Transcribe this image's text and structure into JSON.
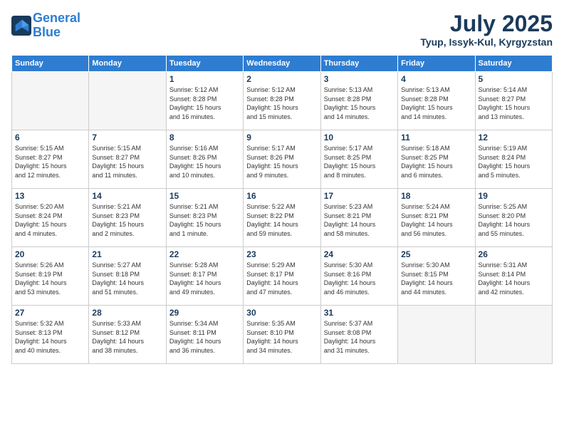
{
  "header": {
    "logo_line1": "General",
    "logo_line2": "Blue",
    "month_year": "July 2025",
    "location": "Tyup, Issyk-Kul, Kyrgyzstan"
  },
  "days_of_week": [
    "Sunday",
    "Monday",
    "Tuesday",
    "Wednesday",
    "Thursday",
    "Friday",
    "Saturday"
  ],
  "weeks": [
    [
      {
        "day": "",
        "content": ""
      },
      {
        "day": "",
        "content": ""
      },
      {
        "day": "1",
        "content": "Sunrise: 5:12 AM\nSunset: 8:28 PM\nDaylight: 15 hours\nand 16 minutes."
      },
      {
        "day": "2",
        "content": "Sunrise: 5:12 AM\nSunset: 8:28 PM\nDaylight: 15 hours\nand 15 minutes."
      },
      {
        "day": "3",
        "content": "Sunrise: 5:13 AM\nSunset: 8:28 PM\nDaylight: 15 hours\nand 14 minutes."
      },
      {
        "day": "4",
        "content": "Sunrise: 5:13 AM\nSunset: 8:28 PM\nDaylight: 15 hours\nand 14 minutes."
      },
      {
        "day": "5",
        "content": "Sunrise: 5:14 AM\nSunset: 8:27 PM\nDaylight: 15 hours\nand 13 minutes."
      }
    ],
    [
      {
        "day": "6",
        "content": "Sunrise: 5:15 AM\nSunset: 8:27 PM\nDaylight: 15 hours\nand 12 minutes."
      },
      {
        "day": "7",
        "content": "Sunrise: 5:15 AM\nSunset: 8:27 PM\nDaylight: 15 hours\nand 11 minutes."
      },
      {
        "day": "8",
        "content": "Sunrise: 5:16 AM\nSunset: 8:26 PM\nDaylight: 15 hours\nand 10 minutes."
      },
      {
        "day": "9",
        "content": "Sunrise: 5:17 AM\nSunset: 8:26 PM\nDaylight: 15 hours\nand 9 minutes."
      },
      {
        "day": "10",
        "content": "Sunrise: 5:17 AM\nSunset: 8:25 PM\nDaylight: 15 hours\nand 8 minutes."
      },
      {
        "day": "11",
        "content": "Sunrise: 5:18 AM\nSunset: 8:25 PM\nDaylight: 15 hours\nand 6 minutes."
      },
      {
        "day": "12",
        "content": "Sunrise: 5:19 AM\nSunset: 8:24 PM\nDaylight: 15 hours\nand 5 minutes."
      }
    ],
    [
      {
        "day": "13",
        "content": "Sunrise: 5:20 AM\nSunset: 8:24 PM\nDaylight: 15 hours\nand 4 minutes."
      },
      {
        "day": "14",
        "content": "Sunrise: 5:21 AM\nSunset: 8:23 PM\nDaylight: 15 hours\nand 2 minutes."
      },
      {
        "day": "15",
        "content": "Sunrise: 5:21 AM\nSunset: 8:23 PM\nDaylight: 15 hours\nand 1 minute."
      },
      {
        "day": "16",
        "content": "Sunrise: 5:22 AM\nSunset: 8:22 PM\nDaylight: 14 hours\nand 59 minutes."
      },
      {
        "day": "17",
        "content": "Sunrise: 5:23 AM\nSunset: 8:21 PM\nDaylight: 14 hours\nand 58 minutes."
      },
      {
        "day": "18",
        "content": "Sunrise: 5:24 AM\nSunset: 8:21 PM\nDaylight: 14 hours\nand 56 minutes."
      },
      {
        "day": "19",
        "content": "Sunrise: 5:25 AM\nSunset: 8:20 PM\nDaylight: 14 hours\nand 55 minutes."
      }
    ],
    [
      {
        "day": "20",
        "content": "Sunrise: 5:26 AM\nSunset: 8:19 PM\nDaylight: 14 hours\nand 53 minutes."
      },
      {
        "day": "21",
        "content": "Sunrise: 5:27 AM\nSunset: 8:18 PM\nDaylight: 14 hours\nand 51 minutes."
      },
      {
        "day": "22",
        "content": "Sunrise: 5:28 AM\nSunset: 8:17 PM\nDaylight: 14 hours\nand 49 minutes."
      },
      {
        "day": "23",
        "content": "Sunrise: 5:29 AM\nSunset: 8:17 PM\nDaylight: 14 hours\nand 47 minutes."
      },
      {
        "day": "24",
        "content": "Sunrise: 5:30 AM\nSunset: 8:16 PM\nDaylight: 14 hours\nand 46 minutes."
      },
      {
        "day": "25",
        "content": "Sunrise: 5:30 AM\nSunset: 8:15 PM\nDaylight: 14 hours\nand 44 minutes."
      },
      {
        "day": "26",
        "content": "Sunrise: 5:31 AM\nSunset: 8:14 PM\nDaylight: 14 hours\nand 42 minutes."
      }
    ],
    [
      {
        "day": "27",
        "content": "Sunrise: 5:32 AM\nSunset: 8:13 PM\nDaylight: 14 hours\nand 40 minutes."
      },
      {
        "day": "28",
        "content": "Sunrise: 5:33 AM\nSunset: 8:12 PM\nDaylight: 14 hours\nand 38 minutes."
      },
      {
        "day": "29",
        "content": "Sunrise: 5:34 AM\nSunset: 8:11 PM\nDaylight: 14 hours\nand 36 minutes."
      },
      {
        "day": "30",
        "content": "Sunrise: 5:35 AM\nSunset: 8:10 PM\nDaylight: 14 hours\nand 34 minutes."
      },
      {
        "day": "31",
        "content": "Sunrise: 5:37 AM\nSunset: 8:08 PM\nDaylight: 14 hours\nand 31 minutes."
      },
      {
        "day": "",
        "content": ""
      },
      {
        "day": "",
        "content": ""
      }
    ]
  ]
}
